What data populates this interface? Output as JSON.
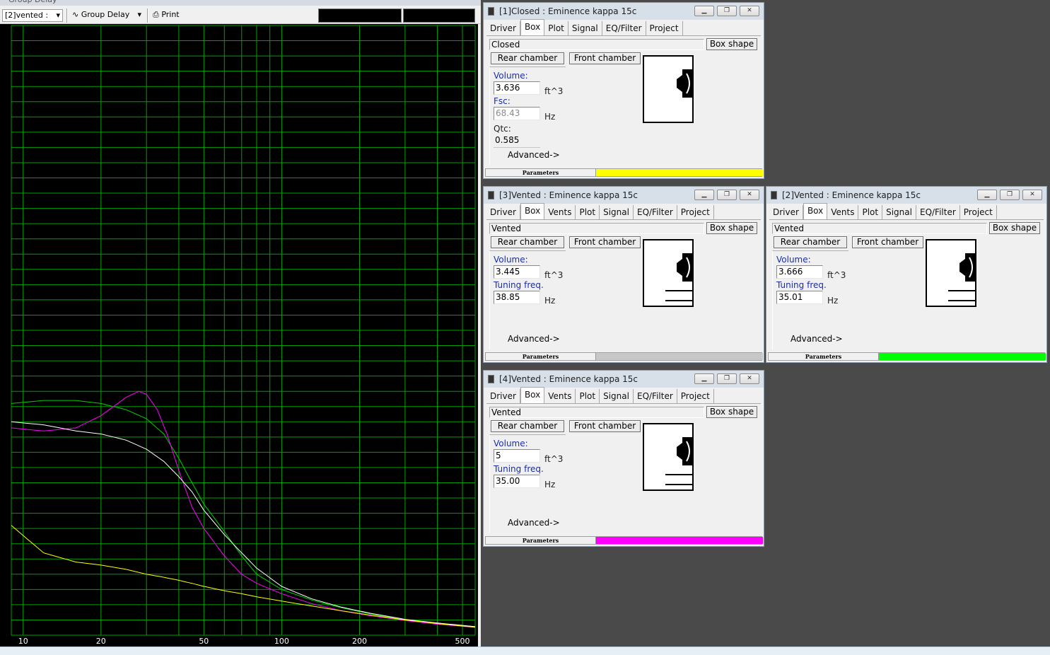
{
  "graph": {
    "title": "Group Delay",
    "project_select": "[2]vented :",
    "mode_label": "Group Delay",
    "print_label": "Print",
    "x_tick_labels": [
      "10",
      "20",
      "50",
      "100",
      "200",
      "500"
    ]
  },
  "windows": [
    {
      "title": "[1]Closed : Eminence kappa 15c",
      "tabs": [
        "Driver",
        "Box",
        "Plot",
        "Signal",
        "EQ/Filter",
        "Project"
      ],
      "active_tab": "Box",
      "box_type": "Closed",
      "box_shape_label": "Box shape",
      "rear_chamber_label": "Rear chamber",
      "front_chamber_label": "Front chamber",
      "p1_label": "Volume:",
      "p1_value": "3.636",
      "p1_unit": "ft^3",
      "p2_label": "Fsc:",
      "p2_value": "68.43",
      "p2_unit": "Hz",
      "p3_label": "Qtc:",
      "p3_value": "0.585",
      "advanced_label": "Advanced->",
      "status_label": "Parameters",
      "status_color": "#ffff00"
    },
    {
      "title": "[3]Vented : Eminence kappa 15c",
      "tabs": [
        "Driver",
        "Box",
        "Vents",
        "Plot",
        "Signal",
        "EQ/Filter",
        "Project"
      ],
      "active_tab": "Box",
      "box_type": "Vented",
      "box_shape_label": "Box shape",
      "rear_chamber_label": "Rear chamber",
      "front_chamber_label": "Front chamber",
      "p1_label": "Volume:",
      "p1_value": "3.445",
      "p1_unit": "ft^3",
      "p2_label": "Tuning freq.",
      "p2_value": "38.85",
      "p2_unit": "Hz",
      "advanced_label": "Advanced->",
      "status_label": "Parameters",
      "status_color": "#c8c8c8"
    },
    {
      "title": "[2]Vented : Eminence kappa 15c",
      "tabs": [
        "Driver",
        "Box",
        "Vents",
        "Plot",
        "Signal",
        "EQ/Filter",
        "Project"
      ],
      "active_tab": "Box",
      "box_type": "Vented",
      "box_shape_label": "Box shape",
      "rear_chamber_label": "Rear chamber",
      "front_chamber_label": "Front chamber",
      "p1_label": "Volume:",
      "p1_value": "3.666",
      "p1_unit": "ft^3",
      "p2_label": "Tuning freq.",
      "p2_value": "35.01",
      "p2_unit": "Hz",
      "advanced_label": "Advanced->",
      "status_label": "Parameters",
      "status_color": "#00ff00"
    },
    {
      "title": "[4]Vented : Eminence kappa 15c",
      "tabs": [
        "Driver",
        "Box",
        "Vents",
        "Plot",
        "Signal",
        "EQ/Filter",
        "Project"
      ],
      "active_tab": "Box",
      "box_type": "Vented",
      "box_shape_label": "Box shape",
      "rear_chamber_label": "Rear chamber",
      "front_chamber_label": "Front chamber",
      "p1_label": "Volume:",
      "p1_value": "5",
      "p1_unit": "ft^3",
      "p2_label": "Tuning freq.",
      "p2_value": "35.00",
      "p2_unit": "Hz",
      "advanced_label": "Advanced->",
      "status_label": "Parameters",
      "status_color": "#ff00ff"
    }
  ],
  "chart_data": {
    "type": "line",
    "x_scale": "log",
    "xlim": [
      9,
      560
    ],
    "ylim": [
      0,
      1
    ],
    "grid": true,
    "background": "#000000",
    "grid_color": "#00a000",
    "series": [
      {
        "color": "#00d000",
        "x": [
          9,
          12,
          16,
          20,
          25,
          30,
          35,
          40,
          45,
          50,
          60,
          70,
          80,
          100,
          130,
          170,
          220,
          300,
          400,
          560
        ],
        "y": [
          0.38,
          0.385,
          0.385,
          0.38,
          0.37,
          0.355,
          0.33,
          0.29,
          0.25,
          0.215,
          0.17,
          0.13,
          0.1,
          0.075,
          0.058,
          0.045,
          0.035,
          0.025,
          0.02,
          0.014
        ]
      },
      {
        "color": "#ff00ff",
        "x": [
          9,
          12,
          16,
          20,
          25,
          28,
          30,
          33,
          36,
          40,
          45,
          50,
          60,
          70,
          80,
          100,
          130,
          170,
          220,
          300,
          400,
          560
        ],
        "y": [
          0.34,
          0.335,
          0.34,
          0.36,
          0.39,
          0.4,
          0.395,
          0.37,
          0.33,
          0.27,
          0.21,
          0.175,
          0.13,
          0.1,
          0.085,
          0.068,
          0.052,
          0.04,
          0.032,
          0.024,
          0.018,
          0.013
        ]
      },
      {
        "color": "#ffffff",
        "x": [
          9,
          12,
          16,
          20,
          25,
          30,
          35,
          40,
          45,
          50,
          60,
          70,
          80,
          100,
          130,
          170,
          220,
          300,
          400,
          560
        ],
        "y": [
          0.35,
          0.345,
          0.335,
          0.33,
          0.32,
          0.305,
          0.285,
          0.26,
          0.235,
          0.205,
          0.165,
          0.135,
          0.11,
          0.08,
          0.06,
          0.046,
          0.036,
          0.026,
          0.02,
          0.014
        ]
      },
      {
        "color": "#ffff00",
        "x": [
          9,
          12,
          16,
          20,
          25,
          30,
          35,
          40,
          45,
          50,
          60,
          70,
          80,
          100,
          130,
          170,
          220,
          300,
          400,
          560
        ],
        "y": [
          0.18,
          0.135,
          0.12,
          0.115,
          0.108,
          0.1,
          0.095,
          0.09,
          0.085,
          0.08,
          0.073,
          0.068,
          0.063,
          0.056,
          0.048,
          0.04,
          0.033,
          0.025,
          0.019,
          0.013
        ]
      }
    ]
  }
}
